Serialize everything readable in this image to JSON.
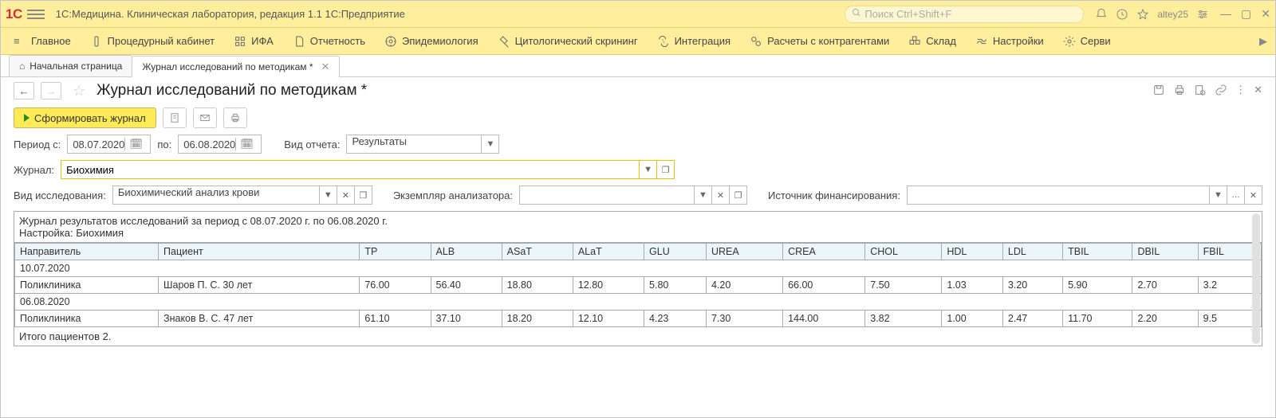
{
  "title": "1С:Медицина. Клиническая лаборатория, редакция 1.1 1С:Предприятие",
  "search_placeholder": "Поиск Ctrl+Shift+F",
  "user": "altey25",
  "menu": {
    "main": "Главное",
    "proc": "Процедурный кабинет",
    "ifa": "ИФА",
    "report": "Отчетность",
    "epid": "Эпидемиология",
    "cyto": "Цитологический скрининг",
    "integ": "Интеграция",
    "calc": "Расчеты с контрагентами",
    "stock": "Склад",
    "settings": "Настройки",
    "service": "Серви"
  },
  "tabs": {
    "home": "Начальная страница",
    "journal": "Журнал исследований по методикам *"
  },
  "page_title": "Журнал исследований по методикам *",
  "form_btn": "Сформировать журнал",
  "filters": {
    "period_from_lbl": "Период с:",
    "period_from": "08.07.2020",
    "period_to_lbl": "по:",
    "period_to": "06.08.2020",
    "report_type_lbl": "Вид отчета:",
    "report_type": "Результаты",
    "journal_lbl": "Журнал:",
    "journal": "Биохимия",
    "research_type_lbl": "Вид исследования:",
    "research_type": "Биохимический анализ крови",
    "analyzer_lbl": "Экземпляр анализатора:",
    "analyzer": "",
    "finance_lbl": "Источник финансирования:",
    "finance": ""
  },
  "report": {
    "desc_line1": "Журнал результатов исследований за период с 08.07.2020 г. по 06.08.2020 г.",
    "desc_line2": "Настройка: Биохимия",
    "headers": [
      "Направитель",
      "Пациент",
      "TP",
      "ALB",
      "ASaT",
      "ALaT",
      "GLU",
      "UREA",
      "CREA",
      "CHOL",
      "HDL",
      "LDL",
      "TBIL",
      "DBIL",
      "FBIL"
    ],
    "groups": [
      {
        "date": "10.07.2020",
        "rows": [
          {
            "ref": "Поликлиника",
            "pat": "Шаров П. С. 30 лет",
            "v": [
              "76.00",
              "56.40",
              "18.80",
              "12.80",
              "5.80",
              "4.20",
              "66.00",
              "7.50",
              "1.03",
              "3.20",
              "5.90",
              "2.70",
              "3.2"
            ]
          }
        ]
      },
      {
        "date": "06.08.2020",
        "rows": [
          {
            "ref": "Поликлиника",
            "pat": "Знаков В. С. 47 лет",
            "v": [
              "61.10",
              "37.10",
              "18.20",
              "12.10",
              "4.23",
              "7.30",
              "144.00",
              "3.82",
              "1.00",
              "2.47",
              "11.70",
              "2.20",
              "9.5"
            ]
          }
        ]
      }
    ],
    "total": "Итого пациентов 2."
  },
  "chart_data": {
    "type": "table",
    "columns": [
      "Направитель",
      "Пациент",
      "TP",
      "ALB",
      "ASaT",
      "ALaT",
      "GLU",
      "UREA",
      "CREA",
      "CHOL",
      "HDL",
      "LDL",
      "TBIL",
      "DBIL",
      "FBIL"
    ],
    "dates": [
      "10.07.2020",
      "06.08.2020"
    ],
    "rows": [
      {
        "date": "10.07.2020",
        "Направитель": "Поликлиника",
        "Пациент": "Шаров П. С. 30 лет",
        "TP": 76.0,
        "ALB": 56.4,
        "ASaT": 18.8,
        "ALaT": 12.8,
        "GLU": 5.8,
        "UREA": 4.2,
        "CREA": 66.0,
        "CHOL": 7.5,
        "HDL": 1.03,
        "LDL": 3.2,
        "TBIL": 5.9,
        "DBIL": 2.7,
        "FBIL": 3.2
      },
      {
        "date": "06.08.2020",
        "Направитель": "Поликлиника",
        "Пациент": "Знаков В. С. 47 лет",
        "TP": 61.1,
        "ALB": 37.1,
        "ASaT": 18.2,
        "ALaT": 12.1,
        "GLU": 4.23,
        "UREA": 7.3,
        "CREA": 144.0,
        "CHOL": 3.82,
        "HDL": 1.0,
        "LDL": 2.47,
        "TBIL": 11.7,
        "DBIL": 2.2,
        "FBIL": 9.5
      }
    ],
    "total_patients": 2
  }
}
